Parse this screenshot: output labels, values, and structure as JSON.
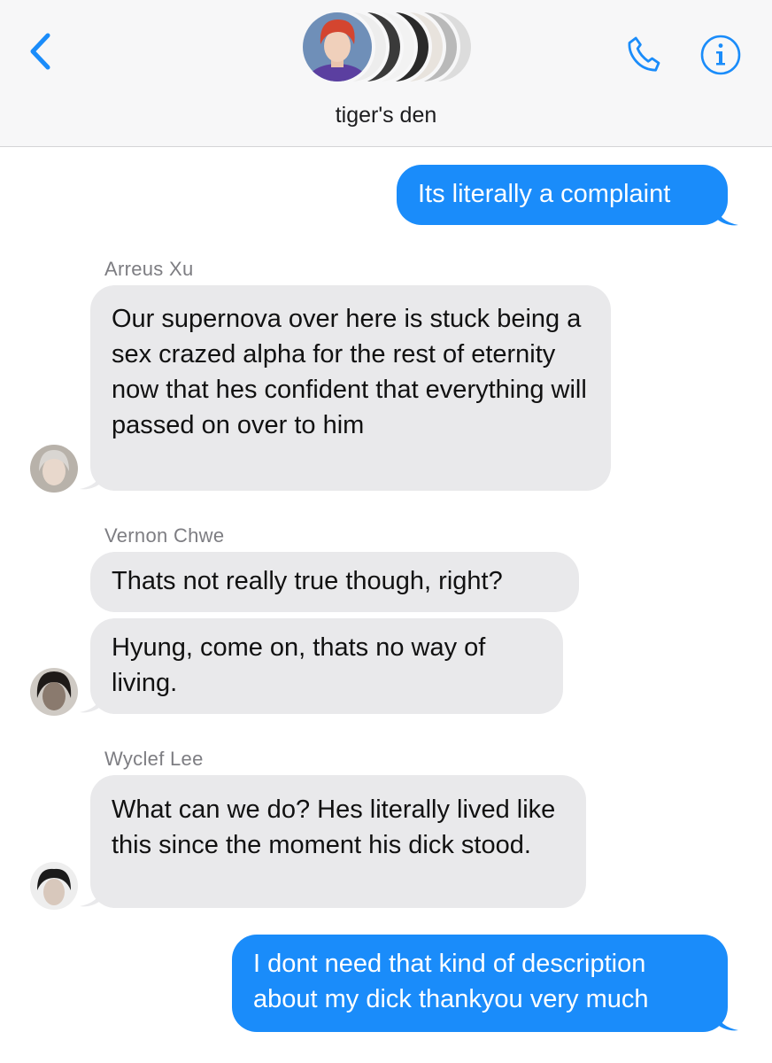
{
  "header": {
    "group_name": "tiger's den",
    "icons": {
      "back": "chevron-left-icon",
      "phone": "phone-icon",
      "info": "info-icon"
    },
    "accent_color": "#1a8cfa"
  },
  "colors": {
    "outgoing_bubble": "#1a8cfa",
    "incoming_bubble": "#e9e9eb",
    "sender_name": "#7d7d82"
  },
  "messages": [
    {
      "sender": "",
      "direction": "outgoing",
      "text": "Its literally a complaint"
    },
    {
      "sender": "Arreus Xu",
      "direction": "incoming",
      "text": "Our supernova over here is stuck being a sex crazed alpha for the rest of eternity now that hes confident that everything will passed on over to him"
    },
    {
      "sender": "Vernon Chwe",
      "direction": "incoming",
      "text": "Thats not really true though, right?"
    },
    {
      "sender": "",
      "direction": "incoming",
      "text": "Hyung, come on, thats no way of living."
    },
    {
      "sender": "Wyclef Lee",
      "direction": "incoming",
      "text": "What can we do? Hes literally lived like this since the moment his dick stood."
    },
    {
      "sender": "",
      "direction": "outgoing",
      "text": "I dont need that kind of description about my dick thankyou very much"
    }
  ]
}
